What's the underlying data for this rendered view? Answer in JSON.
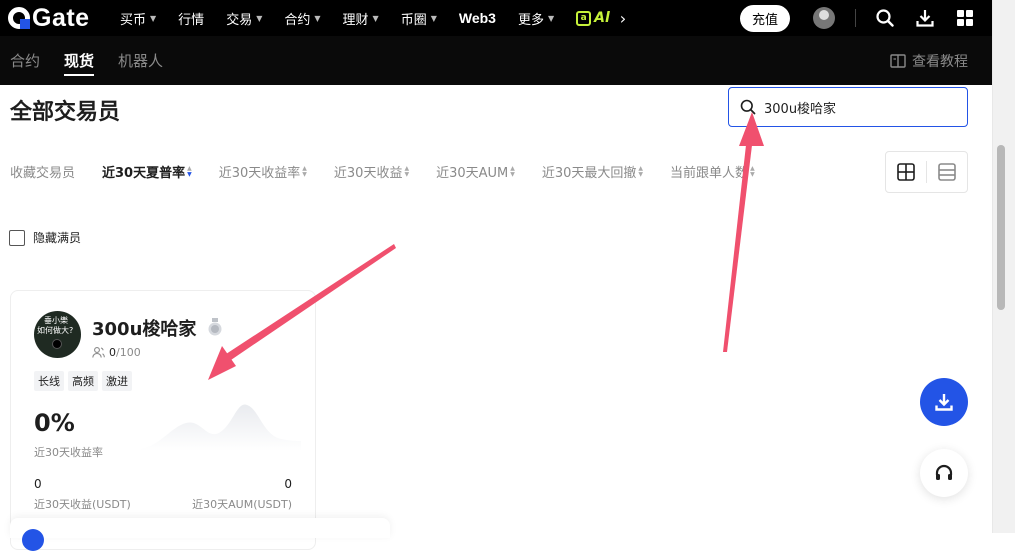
{
  "brand": {
    "name": "Gate"
  },
  "nav": {
    "items": [
      {
        "label": "买币",
        "dropdown": true
      },
      {
        "label": "行情",
        "dropdown": false
      },
      {
        "label": "交易",
        "dropdown": true
      },
      {
        "label": "合约",
        "dropdown": true
      },
      {
        "label": "理财",
        "dropdown": true
      },
      {
        "label": "币圈",
        "dropdown": true
      },
      {
        "label": "Web3",
        "dropdown": false
      },
      {
        "label": "更多",
        "dropdown": true
      }
    ],
    "alpha_label": "Al",
    "deposit_label": "充值",
    "icons": [
      "search-icon",
      "download-icon",
      "apps-grid-icon"
    ]
  },
  "subnav": {
    "tabs": [
      {
        "label": "合约",
        "active": false
      },
      {
        "label": "现货",
        "active": true
      },
      {
        "label": "机器人",
        "active": false
      }
    ],
    "tutorial_label": "查看教程"
  },
  "page": {
    "title": "全部交易员"
  },
  "search": {
    "value": "300u梭哈家"
  },
  "sort": {
    "items": [
      {
        "label": "收藏交易员",
        "sortable": false,
        "active": false
      },
      {
        "label": "近30天夏普率",
        "sortable": true,
        "active": true
      },
      {
        "label": "近30天收益率",
        "sortable": true,
        "active": false
      },
      {
        "label": "近30天收益",
        "sortable": true,
        "active": false
      },
      {
        "label": "近30天AUM",
        "sortable": true,
        "active": false
      },
      {
        "label": "近30天最大回撤",
        "sortable": true,
        "active": false
      },
      {
        "label": "当前跟单人数",
        "sortable": true,
        "active": false
      }
    ]
  },
  "filter": {
    "hide_full_label": "隐藏满员",
    "hide_full_checked": false
  },
  "trader": {
    "name": "300u梭哈家",
    "avatar_text_1": "垂小樂",
    "avatar_text_2": "如何做大?",
    "followers": "0",
    "followers_max": "/100",
    "tags": [
      "长线",
      "高频",
      "激进"
    ],
    "roi": "0%",
    "roi_label": "近30天收益率",
    "pnl_value": "0",
    "pnl_label": "近30天收益(USDT)",
    "aum_value": "0",
    "aum_label": "近30天AUM(USDT)"
  },
  "colors": {
    "accent": "#2354e6",
    "annotation_arrow": "#f0506e",
    "topbar": "#000000",
    "alpha": "#c6f23a"
  }
}
